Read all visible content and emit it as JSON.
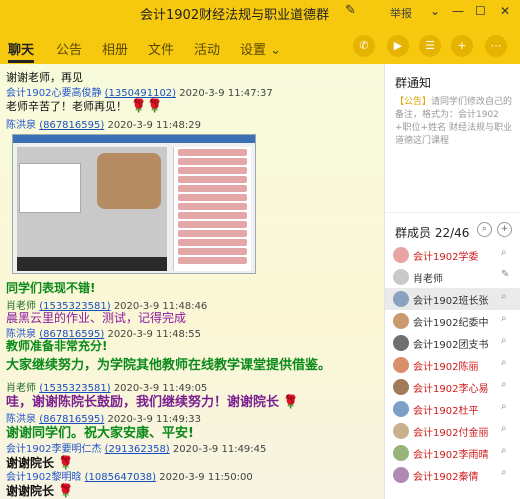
{
  "window": {
    "title": "会计1902财经法规与职业道德群",
    "report_label": "举报"
  },
  "tabs": [
    {
      "label": "聊天",
      "active": true
    },
    {
      "label": "公告",
      "active": false
    },
    {
      "label": "相册",
      "active": false
    },
    {
      "label": "文件",
      "active": false
    },
    {
      "label": "活动",
      "active": false
    },
    {
      "label": "设置 ⌄",
      "active": false
    }
  ],
  "messages": {
    "m0": "谢谢老师，再见",
    "s1": {
      "name": "会计1902心要高俊静",
      "qq": "(1350491102)",
      "time": "2020-3-9 11:47:37"
    },
    "m1": "老师辛苦了！老师再见！",
    "s2": {
      "name": "陈洪泉",
      "qq": "(867816595)",
      "time": "2020-3-9 11:48:29"
    },
    "m2": "同学们表现不错!",
    "s3": {
      "name": "肖老师",
      "qq": "(1535323581)",
      "time": "2020-3-9 11:48:46"
    },
    "m3": "晨黑云里的作业、测试，记得完成",
    "s4": {
      "name": "陈洪泉",
      "qq": "(867816595)",
      "time": "2020-3-9 11:48:55"
    },
    "m4": "教师准备非常充分!",
    "m5": "大家继续努力，为学院其他教师在线教学课堂提供借鉴。",
    "s5": {
      "name": "肖老师",
      "qq": "(1535323581)",
      "time": "2020-3-9 11:49:05"
    },
    "m6": "哇，谢谢陈院长鼓励，我们继续努力！谢谢院长",
    "s6": {
      "name": "陈洪泉",
      "qq": "(867816595)",
      "time": "2020-3-9 11:49:33"
    },
    "m7": "谢谢同学们。祝大家安康、平安!",
    "s7": {
      "name": "会计1902李要明仁杰",
      "qq": "(291362358)",
      "time": "2020-3-9 11:49:45"
    },
    "m8": "谢谢院长",
    "s8": {
      "name": "会计1902黎明晗",
      "qq": "(1085647038)",
      "time": "2020-3-9 11:50:00"
    },
    "m9": "谢谢院长"
  },
  "notice": {
    "title": "群通知",
    "prefix": "【公告】",
    "text": "请同学们修改自己的备注，格式为：会计1902+职位+姓名 财经法规与职业道德这门课程"
  },
  "members": {
    "title": "群成员 22/46",
    "list": [
      {
        "name": "会计1902学委",
        "color": "#d01a1a",
        "avatar": "#e8a3a3"
      },
      {
        "name": "肖老师",
        "color": "#333333",
        "avatar": "#c9c9c9"
      },
      {
        "name": "会计1902班长张",
        "color": "#333333",
        "avatar": "#8aa2c2"
      },
      {
        "name": "会计1902纪委中",
        "color": "#333333",
        "avatar": "#c89a6e"
      },
      {
        "name": "会计1902团支书",
        "color": "#333333",
        "avatar": "#6f6f6f"
      },
      {
        "name": "会计1902陈丽",
        "color": "#d01a1a",
        "avatar": "#d88f6a"
      },
      {
        "name": "会计1902李心易",
        "color": "#d01a1a",
        "avatar": "#a07a5a"
      },
      {
        "name": "会计1902杜平",
        "color": "#d01a1a",
        "avatar": "#7aa0c8"
      },
      {
        "name": "会计1902付金丽",
        "color": "#d01a1a",
        "avatar": "#c7b28d"
      },
      {
        "name": "会计1902李雨晴",
        "color": "#d01a1a",
        "avatar": "#9ab37a"
      },
      {
        "name": "会计1902秦倩",
        "color": "#d01a1a",
        "avatar": "#b08ab5"
      }
    ]
  }
}
